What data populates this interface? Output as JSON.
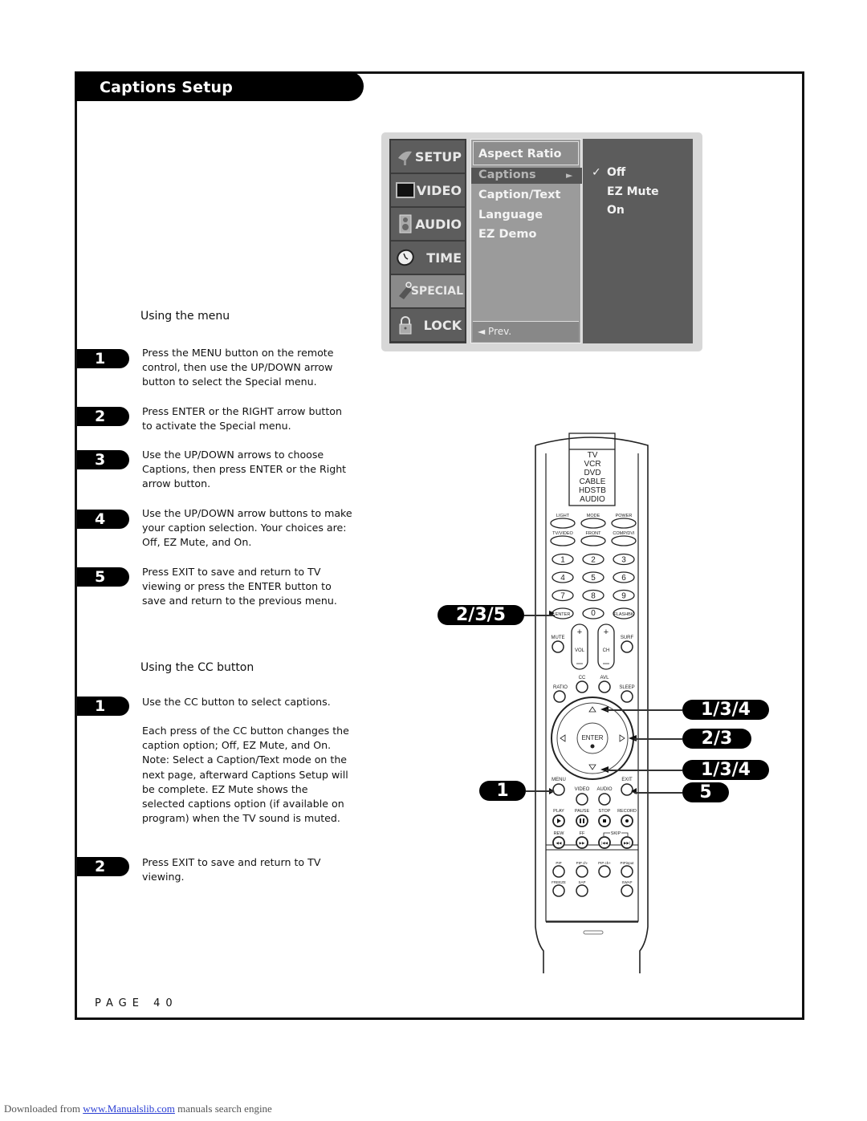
{
  "page": {
    "title": "Captions Setup",
    "page_number": "PAGE 40"
  },
  "using_menu": {
    "heading": "Using the menu",
    "steps": [
      {
        "num": "1",
        "text": "Press the MENU button on the remote control, then use the UP/DOWN arrow button to select the Special menu."
      },
      {
        "num": "2",
        "text": "Press ENTER or the RIGHT arrow button to activate the Special menu."
      },
      {
        "num": "3",
        "text": "Use the UP/DOWN arrows to choose Captions, then press ENTER or the Right arrow button."
      },
      {
        "num": "4",
        "text": "Use the UP/DOWN arrow buttons to make your caption selection. Your choices are: Off, EZ Mute, and On."
      },
      {
        "num": "5",
        "text": "Press EXIT to save and return to TV viewing or press the ENTER button to save and return to the previous menu."
      }
    ]
  },
  "using_cc": {
    "heading": "Using the CC button",
    "steps": [
      {
        "num": "1",
        "text": "Use the CC button to select captions."
      },
      {
        "num": "2",
        "text": "Press EXIT to save and return to TV viewing."
      }
    ],
    "note": "Each press of the CC button changes the caption option; Off, EZ Mute, and On. Note: Select a Caption/Text mode on the next page, afterward Captions Setup will be complete. EZ Mute shows the selected captions option (if available on program) when the TV sound is muted."
  },
  "osd_menu": {
    "tabs": [
      {
        "label": "SETUP",
        "icon": "satellite-dish-icon"
      },
      {
        "label": "VIDEO",
        "icon": "tv-screen-icon"
      },
      {
        "label": "AUDIO",
        "icon": "speaker-icon"
      },
      {
        "label": "TIME",
        "icon": "clock-icon"
      },
      {
        "label": "SPECIAL",
        "icon": "tag-icon",
        "active": true
      },
      {
        "label": "LOCK",
        "icon": "padlock-icon"
      }
    ],
    "items": [
      "Aspect Ratio",
      "Captions",
      "Caption/Text",
      "Language",
      "EZ Demo"
    ],
    "selected_item": "Captions",
    "submenu_arrow": "►",
    "prev_label": "◄ Prev.",
    "options": [
      "Off",
      "EZ Mute",
      "On"
    ],
    "checked_option": "Off",
    "check_mark": "✓"
  },
  "remote": {
    "mode_list": [
      "TV",
      "VCR",
      "DVD",
      "CABLE",
      "HDSTB",
      "AUDIO"
    ],
    "top_buttons": [
      "LIGHT",
      "MODE",
      "POWER",
      "TV/VIDEO",
      "FRONT",
      "COMP/DVI"
    ],
    "number_keys": [
      "1",
      "2",
      "3",
      "4",
      "5",
      "6",
      "7",
      "8",
      "9"
    ],
    "bottom_row_keys": [
      "ENTER",
      "0",
      "FLASHBK"
    ],
    "mute_label": "MUTE",
    "surf_label": "SURF",
    "vol_label": "VOL",
    "ch_label": "CH",
    "cc_label": "CC",
    "avl_label": "AVL",
    "ratio_label": "RATIO",
    "sleep_label": "SLEEP",
    "enter_label": "ENTER",
    "menu_label": "MENU",
    "exit_label": "EXIT",
    "video_label": "VIDEO",
    "audio_label": "AUDIO",
    "transport_labels": [
      "PLAY",
      "PAUSE",
      "STOP",
      "RECORD"
    ],
    "rew_label": "REW",
    "ff_label": "FF",
    "skip_label": "SKIP",
    "pip_labels": [
      "PIP",
      "PIP ch-",
      "PIP ch+",
      "PIPinput"
    ],
    "freeze_label": "FREEZE",
    "sap_label": "SAP",
    "swap_label": "SWAP"
  },
  "callouts": {
    "enter_key": "2/3/5",
    "up_arrow": "1/3/4",
    "right_arrow": "2/3",
    "down_arrow": "1/3/4",
    "menu_key": "1",
    "exit_key": "5"
  },
  "footer": {
    "prefix": "Downloaded from ",
    "link": "www.Manualslib.com",
    "suffix": " manuals search engine"
  }
}
